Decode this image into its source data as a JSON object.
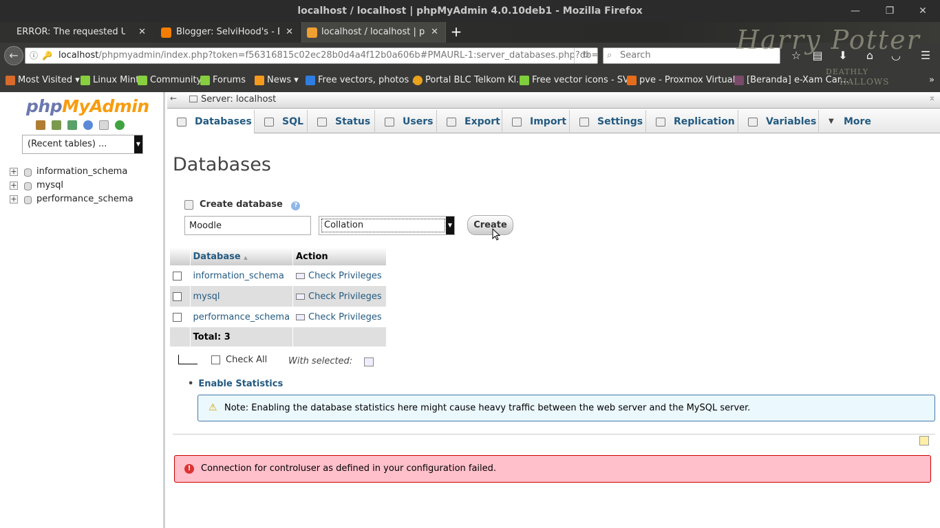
{
  "window": {
    "title": "localhost / localhost | phpMyAdmin 4.0.10deb1 - Mozilla Firefox",
    "controls": {
      "minimize": "—",
      "restore": "❐",
      "close": "✕"
    }
  },
  "tabs": [
    {
      "label": "ERROR: The requested URL c...",
      "favicon": "none",
      "active": false,
      "close": "✕"
    },
    {
      "label": "Blogger: SelviHood's - Bu...",
      "favicon": "blogger-icon",
      "active": false,
      "close": "✕"
    },
    {
      "label": "localhost / localhost | ph...",
      "favicon": "phpmyadmin-icon",
      "active": true,
      "close": "✕"
    }
  ],
  "newtab_label": "+",
  "theme": {
    "line1": "Harry Potter",
    "line2": "DEATHLY",
    "line3": "HALLOWS"
  },
  "navbar": {
    "back": "←",
    "info": "ⓘ",
    "key": "🔑",
    "url_host": "localhost",
    "url_rest": "/phpmyadmin/index.php?token=f56316815c02ec28b0d4a4f12b0a606b#PMAURL-1:server_databases.php?db=&table=&se",
    "reload": "↻",
    "search_placeholder": "Search",
    "search_icon": "⌕",
    "icons": {
      "star": "☆",
      "reader": "▤",
      "download": "⬇",
      "home": "⌂",
      "pocket": "◡",
      "menu": "☰"
    }
  },
  "bookmarks": [
    {
      "label": "Most Visited ▾",
      "icon": "most-visited-icon",
      "color": "#d86a2a"
    },
    {
      "label": "Linux Mint",
      "icon": "linux-mint-icon",
      "color": "#87cf3e"
    },
    {
      "label": "Community",
      "icon": "community-icon",
      "color": "#87cf3e"
    },
    {
      "label": "Forums",
      "icon": "forums-icon",
      "color": "#87cf3e"
    },
    {
      "label": "News ▾",
      "icon": "rss-icon",
      "color": "#f59a1c"
    },
    {
      "label": "Free vectors, photos ...",
      "icon": "freepik-icon",
      "color": "#2f7de1"
    },
    {
      "label": "Portal BLC Telkom Kl...",
      "icon": "telkom-icon",
      "color": "#e8a21c"
    },
    {
      "label": "Free vector icons - SV...",
      "icon": "flaticon-icon",
      "color": "#7fcf3c"
    },
    {
      "label": "pve - Proxmox Virtual...",
      "icon": "proxmox-icon",
      "color": "#e56d1a"
    },
    {
      "label": "[Beranda] e-Xam Car...",
      "icon": "exam-icon",
      "color": "#7a4a6a"
    }
  ],
  "bookmarks_more": "»",
  "sidebar": {
    "logo_php": "php",
    "logo_myadmin": "MyAdmin",
    "recent": "(Recent tables) ...",
    "recent_arrow": "▼",
    "databases": [
      {
        "name": "information_schema",
        "expander": "+"
      },
      {
        "name": "mysql",
        "expander": "+"
      },
      {
        "name": "performance_schema",
        "expander": "+"
      }
    ]
  },
  "topbar": {
    "back": "←",
    "server_label": "Server: localhost",
    "collapse": "⌅"
  },
  "menu": [
    {
      "label": "Databases",
      "active": true
    },
    {
      "label": "SQL",
      "active": false
    },
    {
      "label": "Status",
      "active": false
    },
    {
      "label": "Users",
      "active": false
    },
    {
      "label": "Export",
      "active": false
    },
    {
      "label": "Import",
      "active": false
    },
    {
      "label": "Settings",
      "active": false
    },
    {
      "label": "Replication",
      "active": false
    },
    {
      "label": "Variables",
      "active": false
    },
    {
      "label": "More",
      "active": false
    }
  ],
  "main": {
    "heading": "Databases",
    "create_heading": "Create database",
    "help": "?",
    "db_name_value": "Moodle",
    "collation": "Collation",
    "collation_arrow": "▼",
    "create_button": "Create",
    "table": {
      "headers": {
        "database": "Database",
        "sort_icon": "▲",
        "action": "Action"
      },
      "rows": [
        {
          "name": "information_schema",
          "action": "Check Privileges"
        },
        {
          "name": "mysql",
          "action": "Check Privileges"
        },
        {
          "name": "performance_schema",
          "action": "Check Privileges"
        }
      ],
      "total": "Total: 3"
    },
    "check_all": "Check All",
    "with_selected": "With selected:",
    "enable_statistics": "Enable Statistics",
    "bullet": "•",
    "note_icon": "⚠",
    "note": "Note: Enabling the database statistics here might cause heavy traffic between the web server and the MySQL server.",
    "error_icon": "!",
    "error": "Connection for controluser as defined in your configuration failed."
  }
}
